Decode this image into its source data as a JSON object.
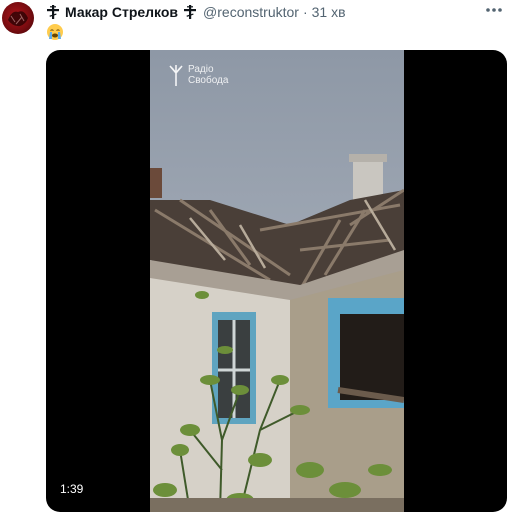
{
  "tweet": {
    "author_name": "Макар Стрелков",
    "handle": "@reconstruktor",
    "separator": "·",
    "time": "31 хв",
    "emoji": "😭"
  },
  "video": {
    "watermark_line1": "Радіо",
    "watermark_line2": "Свобода",
    "duration": "1:39"
  },
  "icons": {
    "avatar": "avatar-image",
    "cross": "orthodox-cross-icon",
    "more": "more-options-icon",
    "watermark": "radio-liberty-logo-icon"
  },
  "colors": {
    "text_primary": "#0f1419",
    "text_secondary": "#536471",
    "media_bg": "#000000"
  }
}
